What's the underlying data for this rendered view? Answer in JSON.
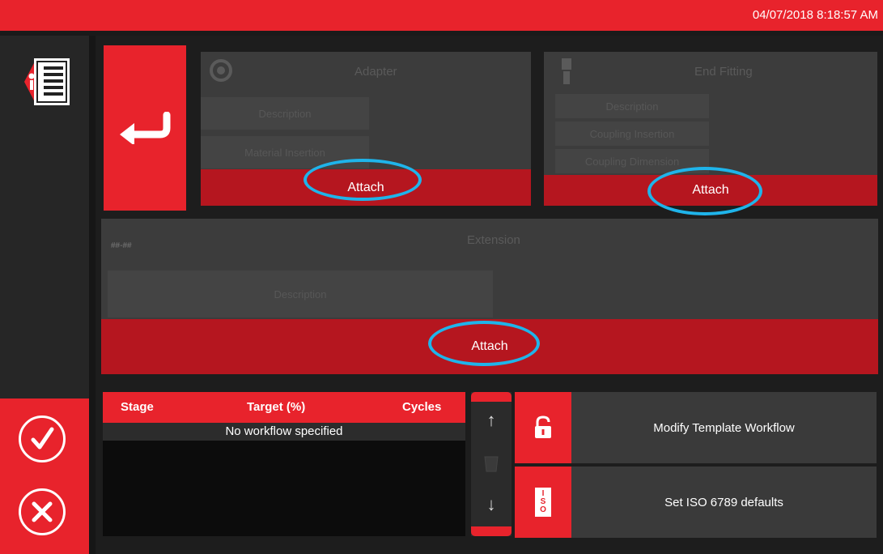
{
  "header": {
    "datetime": "04/07/2018 8:18:57 AM"
  },
  "cards": {
    "adapter": {
      "title": "Adapter",
      "fields": [
        "Description",
        "Material Insertion"
      ],
      "attach_label": "Attach"
    },
    "end_fitting": {
      "title": "End Fitting",
      "fields": [
        "Description",
        "Coupling Insertion",
        "Coupling Dimension"
      ],
      "attach_label": "Attach"
    },
    "extension": {
      "title": "Extension",
      "tag": "##-##",
      "fields": [
        "Description"
      ],
      "attach_label": "Attach"
    }
  },
  "workflow_table": {
    "columns": [
      "Stage",
      "Target (%)",
      "Cycles"
    ],
    "empty_message": "No workflow specified"
  },
  "scroll": {
    "up": "↑",
    "down": "↓"
  },
  "actions": {
    "modify_label": "Modify Template Workflow",
    "iso_label": "Set ISO 6789 defaults",
    "iso_icon_text": "ISO"
  },
  "colors": {
    "accent": "#e8232c",
    "attach": "#b5161f",
    "highlight": "#1fb4ea",
    "panel": "#3c3c3c"
  },
  "icons": [
    "document-icon",
    "back-arrow-icon",
    "checkmark-icon",
    "close-icon",
    "gear-icon",
    "connector-icon",
    "lock-open-icon",
    "iso-icon",
    "scroll-up-icon",
    "scroll-down-icon"
  ]
}
